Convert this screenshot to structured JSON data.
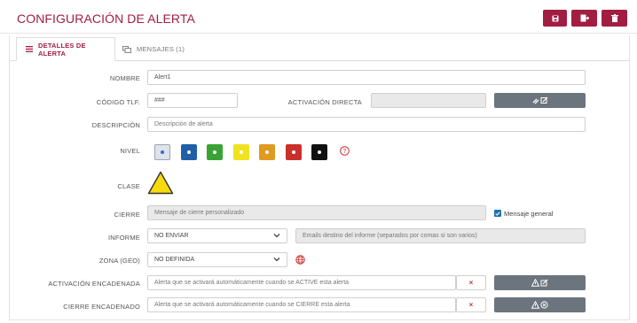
{
  "header": {
    "title": "CONFIGURACIÓN DE ALERTA"
  },
  "tabs": [
    {
      "label": "DETALLES DE ALERTA",
      "icon": "list-icon",
      "active": true
    },
    {
      "label": "MENSAJES (1)",
      "icon": "messages-icon",
      "active": false
    }
  ],
  "form": {
    "nombre": {
      "label": "NOMBRE",
      "value": "Alert1"
    },
    "codigo": {
      "label": "CÓDIGO TLF.",
      "value": "###"
    },
    "activacion_directa": {
      "label": "ACTIVACIÓN DIRECTA",
      "value": ""
    },
    "descripcion": {
      "label": "DESCRIPCIÓN",
      "placeholder": "Descripción de alerta"
    },
    "nivel": {
      "label": "NIVEL",
      "colors": [
        "#dfe3ea",
        "#1f5fa6",
        "#3aa335",
        "#f0e21f",
        "#e09a20",
        "#c9302c",
        "#111111"
      ],
      "selected": 0
    },
    "clase": {
      "label": "CLASE",
      "icon": "warning-triangle-icon"
    },
    "cierre": {
      "label": "CIERRE",
      "placeholder": "Mensaje de cierre personalizado",
      "checkbox_label": "Mensaje general",
      "checked": true
    },
    "informe": {
      "label": "INFORME",
      "selected": "NO ENVIAR",
      "emails_placeholder": "Emails destino del informe (separados por comas si son varios)"
    },
    "zona": {
      "label": "ZONA (GEO)",
      "selected": "NO DEFINIDA"
    },
    "activacion_encadenada": {
      "label": "ACTIVACIÓN ENCADENADA",
      "placeholder": "Alerta que se activará automáticamente cuando se ACTIVE esta alerta"
    },
    "cierre_encadenado": {
      "label": "CIERRE ENCADENADO",
      "placeholder": "Alerta que se activará automáticamente cuando se CIERRE esta alerta"
    }
  },
  "colors": {
    "brand": "#a21d42",
    "button_gray": "#6c757d"
  }
}
